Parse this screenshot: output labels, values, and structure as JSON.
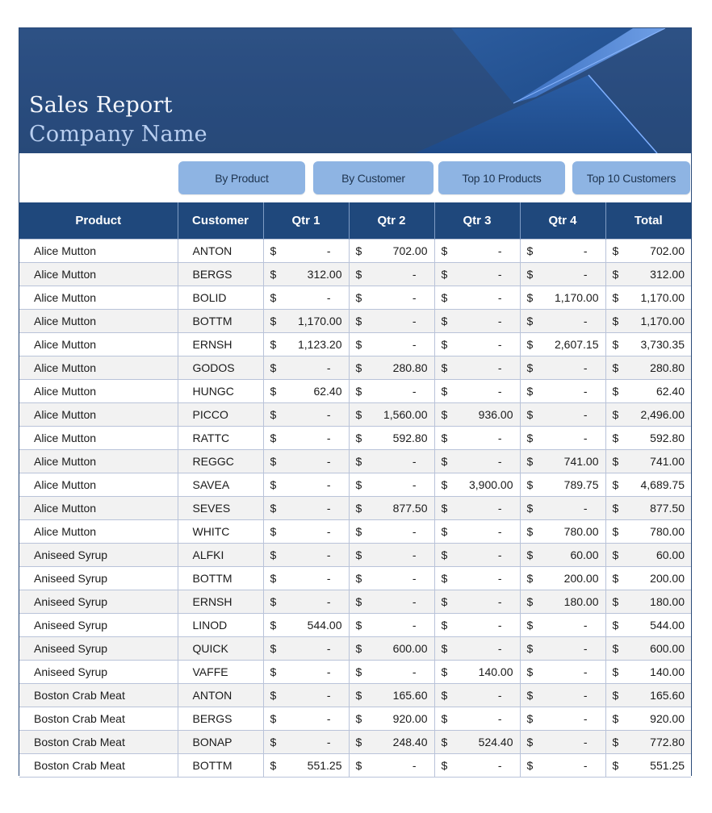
{
  "header": {
    "title": "Sales Report",
    "subtitle": "Company Name"
  },
  "colors": {
    "banner": "#2a4d80",
    "header_row": "#1f487c",
    "button": "#8eb4e3",
    "row_alt": "#f2f2f2",
    "grid_line": "#b9c3d9"
  },
  "nav_buttons": [
    {
      "label": "By Product"
    },
    {
      "label": "By Customer"
    },
    {
      "label": "Top 10 Products"
    },
    {
      "label": "Top 10 Customers"
    }
  ],
  "table": {
    "columns": [
      "Product",
      "Customer",
      "Qtr 1",
      "Qtr 2",
      "Qtr 3",
      "Qtr 4",
      "Total"
    ],
    "currency_symbol": "$",
    "rows": [
      {
        "product": "Alice Mutton",
        "customer": "ANTON",
        "q1": "-",
        "q2": "702.00",
        "q3": "-",
        "q4": "-",
        "total": "702.00"
      },
      {
        "product": "Alice Mutton",
        "customer": "BERGS",
        "q1": "312.00",
        "q2": "-",
        "q3": "-",
        "q4": "-",
        "total": "312.00"
      },
      {
        "product": "Alice Mutton",
        "customer": "BOLID",
        "q1": "-",
        "q2": "-",
        "q3": "-",
        "q4": "1,170.00",
        "total": "1,170.00"
      },
      {
        "product": "Alice Mutton",
        "customer": "BOTTM",
        "q1": "1,170.00",
        "q2": "-",
        "q3": "-",
        "q4": "-",
        "total": "1,170.00"
      },
      {
        "product": "Alice Mutton",
        "customer": "ERNSH",
        "q1": "1,123.20",
        "q2": "-",
        "q3": "-",
        "q4": "2,607.15",
        "total": "3,730.35"
      },
      {
        "product": "Alice Mutton",
        "customer": "GODOS",
        "q1": "-",
        "q2": "280.80",
        "q3": "-",
        "q4": "-",
        "total": "280.80"
      },
      {
        "product": "Alice Mutton",
        "customer": "HUNGC",
        "q1": "62.40",
        "q2": "-",
        "q3": "-",
        "q4": "-",
        "total": "62.40"
      },
      {
        "product": "Alice Mutton",
        "customer": "PICCO",
        "q1": "-",
        "q2": "1,560.00",
        "q3": "936.00",
        "q4": "-",
        "total": "2,496.00"
      },
      {
        "product": "Alice Mutton",
        "customer": "RATTC",
        "q1": "-",
        "q2": "592.80",
        "q3": "-",
        "q4": "-",
        "total": "592.80"
      },
      {
        "product": "Alice Mutton",
        "customer": "REGGC",
        "q1": "-",
        "q2": "-",
        "q3": "-",
        "q4": "741.00",
        "total": "741.00"
      },
      {
        "product": "Alice Mutton",
        "customer": "SAVEA",
        "q1": "-",
        "q2": "-",
        "q3": "3,900.00",
        "q4": "789.75",
        "total": "4,689.75"
      },
      {
        "product": "Alice Mutton",
        "customer": "SEVES",
        "q1": "-",
        "q2": "877.50",
        "q3": "-",
        "q4": "-",
        "total": "877.50"
      },
      {
        "product": "Alice Mutton",
        "customer": "WHITC",
        "q1": "-",
        "q2": "-",
        "q3": "-",
        "q4": "780.00",
        "total": "780.00"
      },
      {
        "product": "Aniseed Syrup",
        "customer": "ALFKI",
        "q1": "-",
        "q2": "-",
        "q3": "-",
        "q4": "60.00",
        "total": "60.00"
      },
      {
        "product": "Aniseed Syrup",
        "customer": "BOTTM",
        "q1": "-",
        "q2": "-",
        "q3": "-",
        "q4": "200.00",
        "total": "200.00"
      },
      {
        "product": "Aniseed Syrup",
        "customer": "ERNSH",
        "q1": "-",
        "q2": "-",
        "q3": "-",
        "q4": "180.00",
        "total": "180.00"
      },
      {
        "product": "Aniseed Syrup",
        "customer": "LINOD",
        "q1": "544.00",
        "q2": "-",
        "q3": "-",
        "q4": "-",
        "total": "544.00"
      },
      {
        "product": "Aniseed Syrup",
        "customer": "QUICK",
        "q1": "-",
        "q2": "600.00",
        "q3": "-",
        "q4": "-",
        "total": "600.00"
      },
      {
        "product": "Aniseed Syrup",
        "customer": "VAFFE",
        "q1": "-",
        "q2": "-",
        "q3": "140.00",
        "q4": "-",
        "total": "140.00"
      },
      {
        "product": "Boston Crab Meat",
        "customer": "ANTON",
        "q1": "-",
        "q2": "165.60",
        "q3": "-",
        "q4": "-",
        "total": "165.60"
      },
      {
        "product": "Boston Crab Meat",
        "customer": "BERGS",
        "q1": "-",
        "q2": "920.00",
        "q3": "-",
        "q4": "-",
        "total": "920.00"
      },
      {
        "product": "Boston Crab Meat",
        "customer": "BONAP",
        "q1": "-",
        "q2": "248.40",
        "q3": "524.40",
        "q4": "-",
        "total": "772.80"
      },
      {
        "product": "Boston Crab Meat",
        "customer": "BOTTM",
        "q1": "551.25",
        "q2": "-",
        "q3": "-",
        "q4": "-",
        "total": "551.25"
      }
    ]
  }
}
